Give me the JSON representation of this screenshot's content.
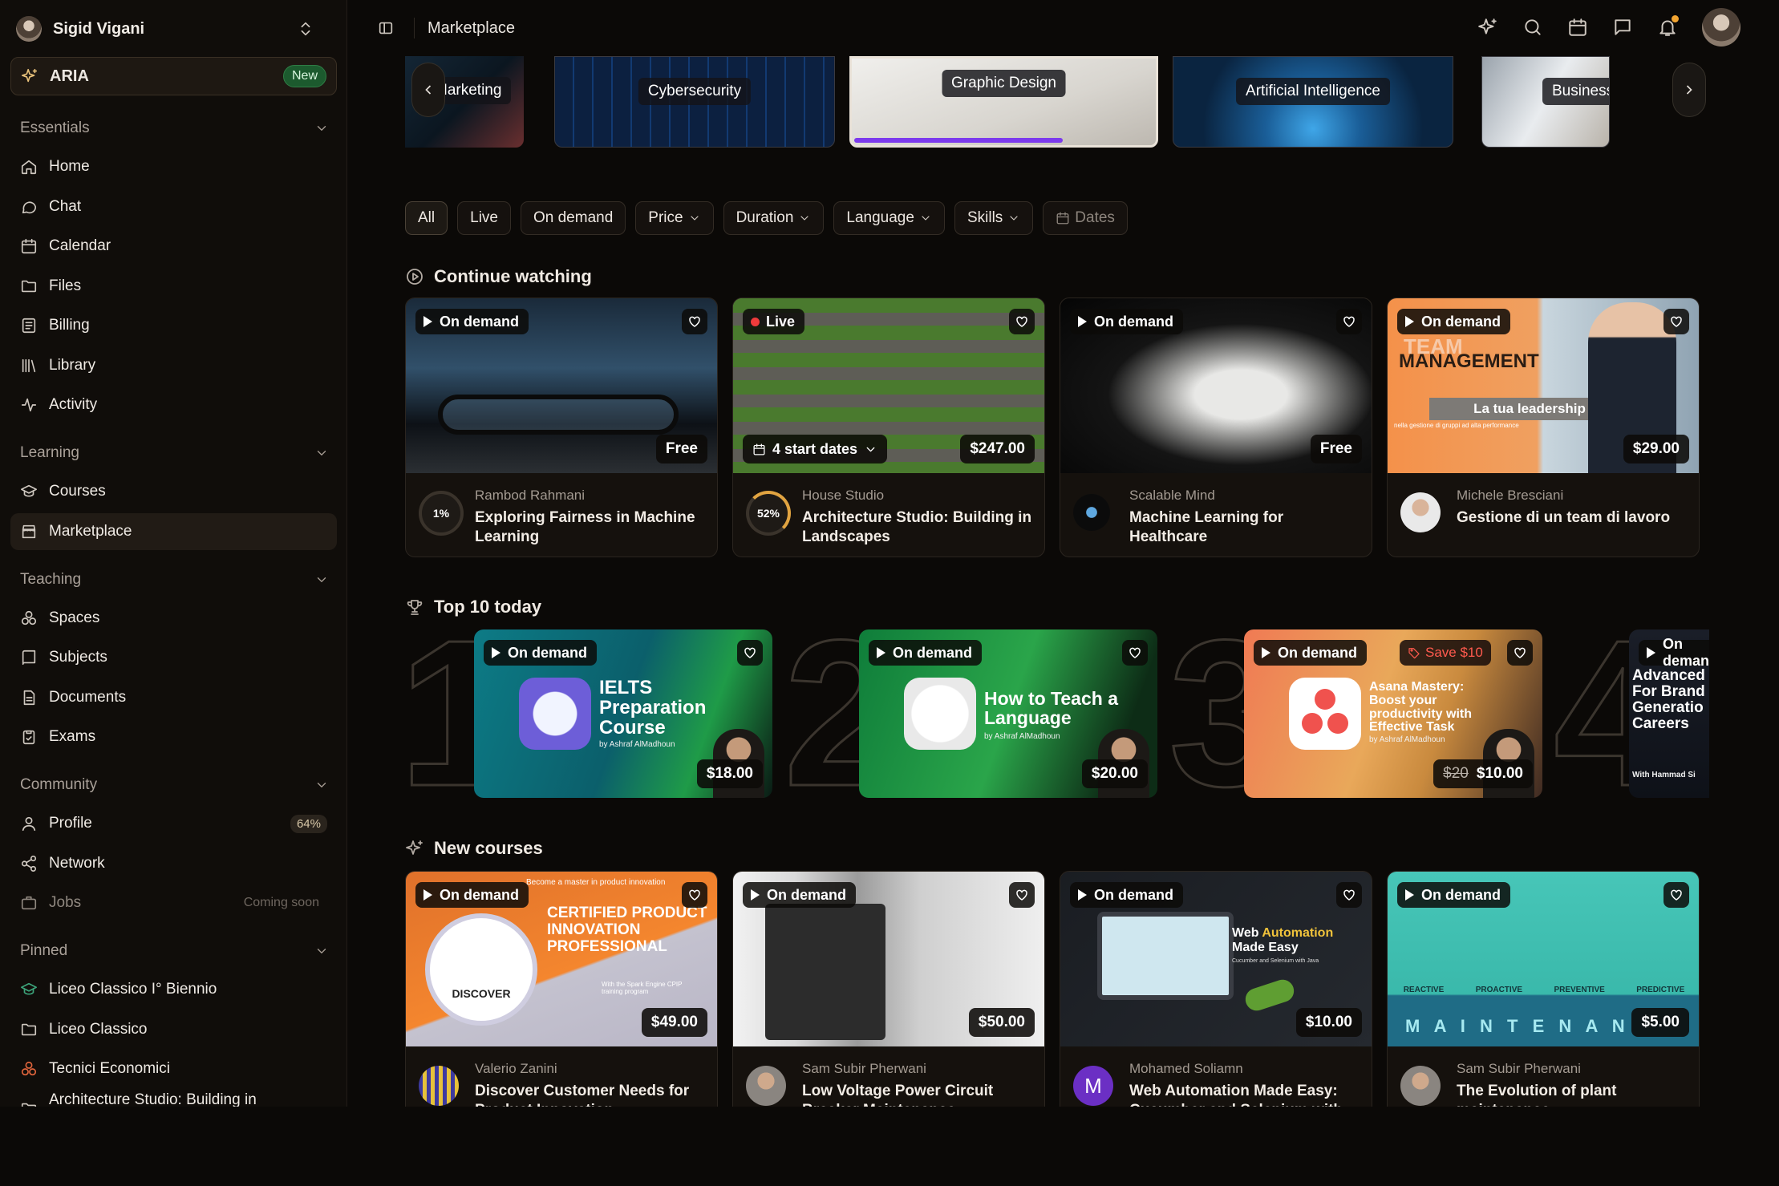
{
  "user": {
    "name": "Sigid Vigani"
  },
  "aria": {
    "label": "ARIA",
    "badge": "New"
  },
  "sidebar": {
    "essentials": {
      "title": "Essentials",
      "items": [
        {
          "label": "Home"
        },
        {
          "label": "Chat"
        },
        {
          "label": "Calendar"
        },
        {
          "label": "Files"
        },
        {
          "label": "Billing"
        },
        {
          "label": "Library"
        },
        {
          "label": "Activity"
        }
      ]
    },
    "learning": {
      "title": "Learning",
      "items": [
        {
          "label": "Courses"
        },
        {
          "label": "Marketplace"
        }
      ]
    },
    "teaching": {
      "title": "Teaching",
      "items": [
        {
          "label": "Spaces"
        },
        {
          "label": "Subjects"
        },
        {
          "label": "Documents"
        },
        {
          "label": "Exams"
        }
      ]
    },
    "community": {
      "title": "Community",
      "items": [
        {
          "label": "Profile",
          "badge": "64%"
        },
        {
          "label": "Network"
        },
        {
          "label": "Jobs",
          "note": "Coming soon"
        }
      ]
    },
    "pinned": {
      "title": "Pinned",
      "items": [
        {
          "label": "Liceo Classico I° Biennio"
        },
        {
          "label": "Liceo Classico"
        },
        {
          "label": "Tecnici Economici"
        },
        {
          "label": "Architecture Studio: Building in Landscapes"
        }
      ]
    }
  },
  "topbar": {
    "title": "Marketplace"
  },
  "categories": [
    {
      "label": "Marketing"
    },
    {
      "label": "Cybersecurity"
    },
    {
      "label": "Graphic Design"
    },
    {
      "label": "Artificial Intelligence"
    },
    {
      "label": "Business"
    }
  ],
  "filters": [
    {
      "label": "All"
    },
    {
      "label": "Live"
    },
    {
      "label": "On demand"
    },
    {
      "label": "Price"
    },
    {
      "label": "Duration"
    },
    {
      "label": "Language"
    },
    {
      "label": "Skills"
    },
    {
      "label": "Dates"
    }
  ],
  "continue": {
    "title": "Continue watching",
    "cards": [
      {
        "badge": "On demand",
        "price": "Free",
        "author": "Rambod Rahmani",
        "title": "Exploring Fairness in Machine Learning",
        "progress": "1%"
      },
      {
        "badge": "Live",
        "price": "$247.00",
        "dates": "4 start dates",
        "author": "House Studio",
        "title": "Architecture Studio: Building in Landscapes",
        "progress": "52%"
      },
      {
        "badge": "On demand",
        "price": "Free",
        "author": "Scalable Mind",
        "title": "Machine Learning for Healthcare"
      },
      {
        "badge": "On demand",
        "price": "$29.00",
        "author": "Michele Bresciani",
        "title": "Gestione di un team di lavoro",
        "cover_line1": "TEAM",
        "cover_line2": "MANAGEMENT",
        "cover_line3": "La tua leadership",
        "cover_line4": "nella gestione di gruppi ad alta performance"
      }
    ]
  },
  "top10": {
    "title": "Top 10 today",
    "items": [
      {
        "rank": "1",
        "badge": "On demand",
        "price": "$18.00",
        "cover_title": "IELTS Preparation Course",
        "cover_sub": "by Ashraf AlMadhoun"
      },
      {
        "rank": "2",
        "badge": "On demand",
        "price": "$20.00",
        "cover_title": "How to Teach a Language",
        "cover_sub": "by Ashraf AlMadhoun"
      },
      {
        "rank": "3",
        "badge": "On demand",
        "price": "$10.00",
        "old_price": "$20",
        "save": "Save $10",
        "cover_title": "Asana Mastery: Boost your productivity with Effective Task",
        "cover_sub": "by Ashraf AlMadhoun"
      },
      {
        "rank": "4",
        "badge": "On demand",
        "cover_title": "Advanced For Brand Generatio Careers",
        "cover_sub": "With Hammad Si"
      }
    ]
  },
  "newcourses": {
    "title": "New courses",
    "cards": [
      {
        "badge": "On demand",
        "price": "$49.00",
        "author": "Valerio Zanini",
        "title": "Discover Customer Needs for Product Innovation",
        "cover_top": "Become a master in product innovation",
        "cover_main": "CERTIFIED PRODUCT INNOVATION PROFESSIONAL",
        "cover_sub": "With the Spark Engine CPIP training program",
        "cover_disc": "DISCOVER"
      },
      {
        "badge": "On demand",
        "price": "$50.00",
        "author": "Sam Subir Pherwani",
        "title": "Low Voltage Power Circuit Breaker Maintenance"
      },
      {
        "badge": "On demand",
        "price": "$10.00",
        "author": "Mohamed Soliamn",
        "title": "Web Automation Made Easy: Cucumber and Selenium with Java",
        "author_initial": "M",
        "cover_t1": "Web ",
        "cover_t1b": "Automation",
        "cover_t2": "Made Easy",
        "cover_t3": "Cucumber and Selenium with Java"
      },
      {
        "badge": "On demand",
        "price": "$5.00",
        "author": "Sam Subir Pherwani",
        "title": "The Evolution of plant maintenance",
        "cover_labels": [
          "REACTIVE",
          "PROACTIVE",
          "PREVENTIVE",
          "PREDICTIVE"
        ],
        "cover_word": "M A I N T E N A N"
      }
    ]
  }
}
